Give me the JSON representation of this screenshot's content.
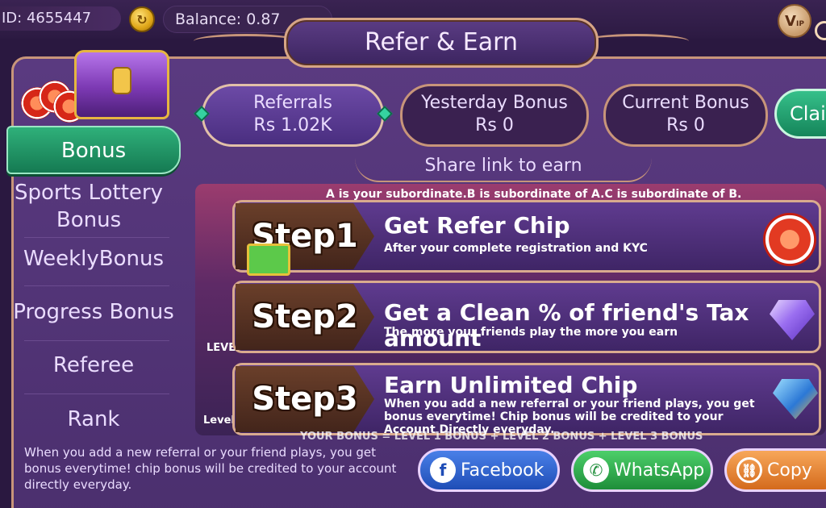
{
  "header": {
    "user_id": "ID: 4655447",
    "balance": "Balance: 0.87",
    "vip": "V",
    "vip_sub": "IP"
  },
  "title": "Refer & Earn",
  "sidebar": {
    "items": [
      {
        "label": "Bonus",
        "active": true
      },
      {
        "label": "Sports Lottery Bonus"
      },
      {
        "label": "WeeklyBonus"
      },
      {
        "label": "Progress Bonus"
      },
      {
        "label": "Referee"
      },
      {
        "label": "Rank"
      }
    ],
    "footer_note": "When you add a new referral or your friend plays, you get bonus everytime! chip bonus will be credited to your account directly everyday."
  },
  "stats": [
    {
      "label": "Referrals",
      "value": "Rs 1.02K"
    },
    {
      "label": "Yesterday Bonus",
      "value": "Rs 0"
    },
    {
      "label": "Current Bonus",
      "value": "Rs 0"
    }
  ],
  "claim_label": "Clai",
  "share_link_label": "Share link to earn",
  "hint": "A is your subordinate.B is subordinate of A.C is subordinate of B.",
  "steps": [
    {
      "tag": "Step1",
      "title": "Get Refer Chip",
      "desc": "After your complete registration and KYC"
    },
    {
      "tag": "Step2",
      "title": "Get a Clean % of friend's Tax amount",
      "desc": "The more your friends play the more you earn"
    },
    {
      "tag": "Step3",
      "title": "Earn Unlimited Chip",
      "desc": "When you add a new referral or your friend plays, you get bonus everytime! Chip bonus will be credited to your Account Directly everyday."
    }
  ],
  "bonus_strip": "YOUR BONUS = LEVEL 1 BONUS + LEVEL 2 BONUS + LEVEL 3 BONUS",
  "level_labels": [
    "LEVE",
    "Level"
  ],
  "share_buttons": {
    "facebook": "Facebook",
    "whatsapp": "WhatsApp",
    "copy": "Copy"
  },
  "colors": {
    "accent_green": "#2fb07a",
    "border_gold": "#c8957a",
    "panel_purple": "#5a3a80"
  }
}
